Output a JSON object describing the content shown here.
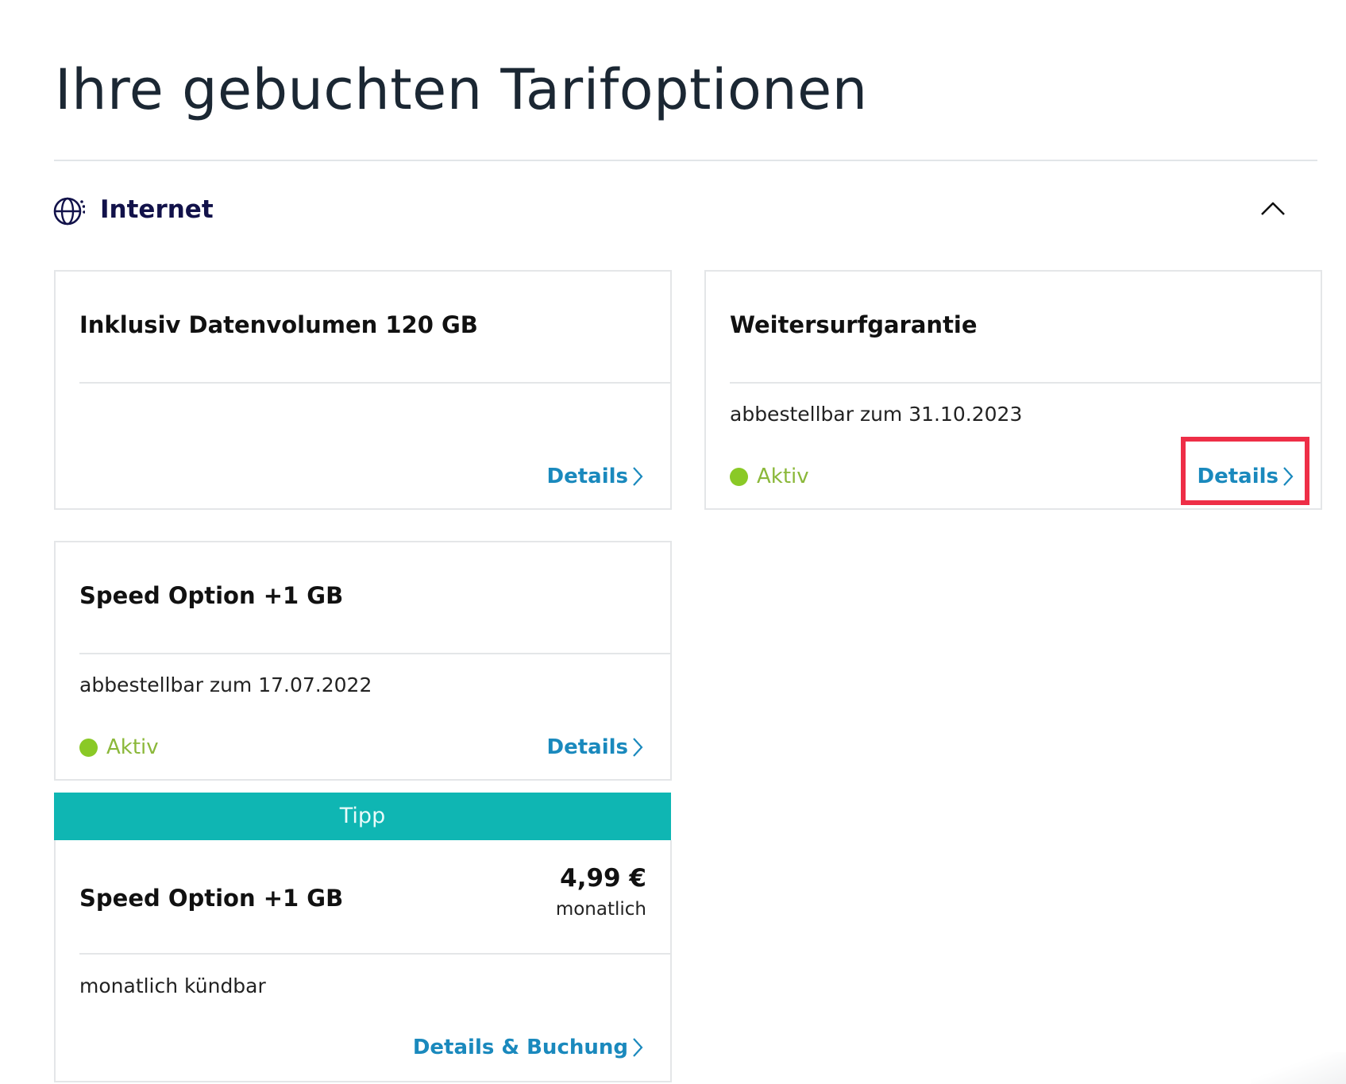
{
  "page": {
    "title": "Ihre gebuchten Tarifoptionen"
  },
  "section": {
    "title": "Internet",
    "icon": "globe-icon",
    "toggle_icon": "chevron-up-icon"
  },
  "colors": {
    "active_green": "#8ac926",
    "link_blue": "#1a89bd",
    "tip_teal": "#0fb6b3",
    "highlight_red": "#ee2e47",
    "section_title_navy": "#12124a"
  },
  "cards": [
    {
      "title": "Inklusiv Datenvolumen 120 GB",
      "note": "",
      "status": "",
      "link_label": "Details"
    },
    {
      "title": "Weitersurfgarantie",
      "note": "abbestellbar zum 31.10.2023",
      "status": "Aktiv",
      "link_label": "Details"
    },
    {
      "title": "Speed Option +1 GB",
      "note": "abbestellbar zum 17.07.2022",
      "status": "Aktiv",
      "link_label": "Details"
    }
  ],
  "tip": {
    "banner": "Tipp",
    "title": "Speed Option +1 GB",
    "price": "4,99 €",
    "price_period": "monatlich",
    "note": "monatlich kündbar",
    "link_label": "Details & Buchung"
  }
}
